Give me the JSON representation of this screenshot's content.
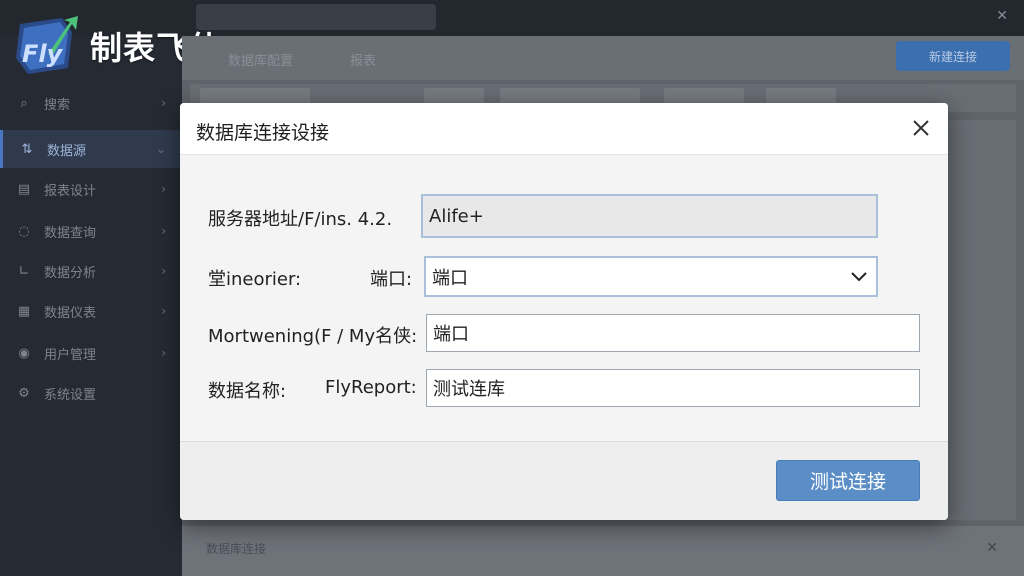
{
  "brand": {
    "name": "制表飞侠",
    "logo_text": "Fly"
  },
  "sidebar": {
    "items": [
      {
        "label": "搜索",
        "icon": "search-icon"
      },
      {
        "label": "数据源",
        "icon": "datasource-icon"
      },
      {
        "label": "报表设计",
        "icon": "report-icon"
      },
      {
        "label": "数据查询",
        "icon": "query-icon"
      },
      {
        "label": "数据分析",
        "icon": "analysis-icon"
      },
      {
        "label": "数据仪表",
        "icon": "dashboard-icon"
      },
      {
        "label": "用户管理",
        "icon": "user-icon"
      },
      {
        "label": "系统设置",
        "icon": "settings-icon"
      }
    ]
  },
  "background": {
    "toolbar_tab1": "数据库配置",
    "toolbar_tab2": "报表",
    "primary_action": "新建连接",
    "row_label": "数据库连接"
  },
  "dialog": {
    "title": "数据库连接设接",
    "fields": {
      "server": {
        "label": "服务器地址/F/ins. 4.2.",
        "value": "Alife+"
      },
      "port": {
        "label_left": "堂ineorier:",
        "label_right": "端口:",
        "value": "端口"
      },
      "user": {
        "label": "Mortwening(F / My名侠:",
        "value": "端口"
      },
      "dbname": {
        "label_left": "数据名称:",
        "label_right": "FlyReport:",
        "value": "测试连库"
      }
    },
    "test_button": "测试连接"
  },
  "colors": {
    "accent": "#5b8ec7",
    "sidebar_bg": "#262b33",
    "dialog_bg": "#f4f4f4"
  }
}
